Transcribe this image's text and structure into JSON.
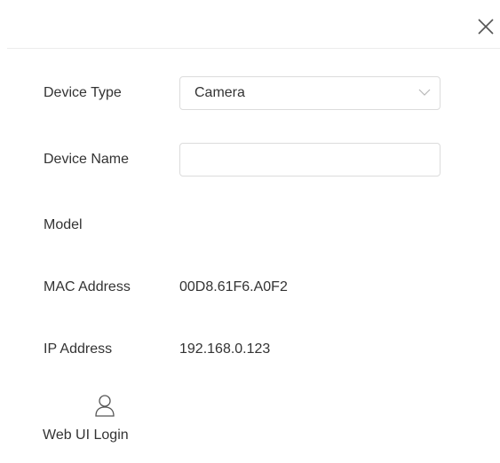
{
  "dialog": {
    "close_icon": "close-icon"
  },
  "form": {
    "device_type": {
      "label": "Device Type",
      "value": "Camera",
      "icon": "chevron-down-icon"
    },
    "device_name": {
      "label": "Device Name",
      "value": ""
    },
    "model": {
      "label": "Model",
      "value": ""
    },
    "mac_address": {
      "label": "MAC Address",
      "value": "00D8.61F6.A0F2"
    },
    "ip_address": {
      "label": "IP Address",
      "value": "192.168.0.123"
    }
  },
  "web_ui_login": {
    "label": "Web UI Login",
    "icon": "user-icon"
  }
}
